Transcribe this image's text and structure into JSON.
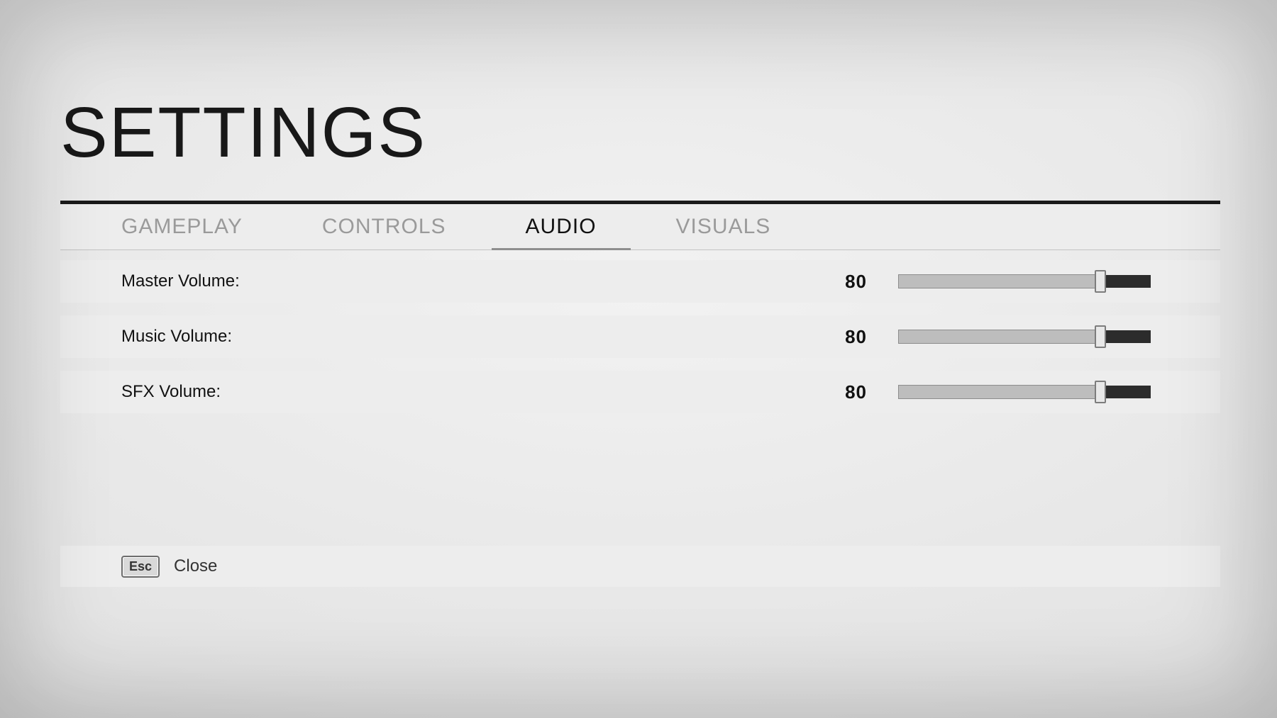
{
  "title": "SETTINGS",
  "tabs": [
    {
      "label": "GAMEPLAY",
      "active": false
    },
    {
      "label": "CONTROLS",
      "active": false
    },
    {
      "label": "AUDIO",
      "active": true
    },
    {
      "label": "VISUALS",
      "active": false
    }
  ],
  "settings": [
    {
      "label": "Master Volume:",
      "value": 80,
      "max": 100
    },
    {
      "label": "Music Volume:",
      "value": 80,
      "max": 100
    },
    {
      "label": "SFX Volume:",
      "value": 80,
      "max": 100
    }
  ],
  "footer": {
    "key": "Esc",
    "label": "Close"
  }
}
